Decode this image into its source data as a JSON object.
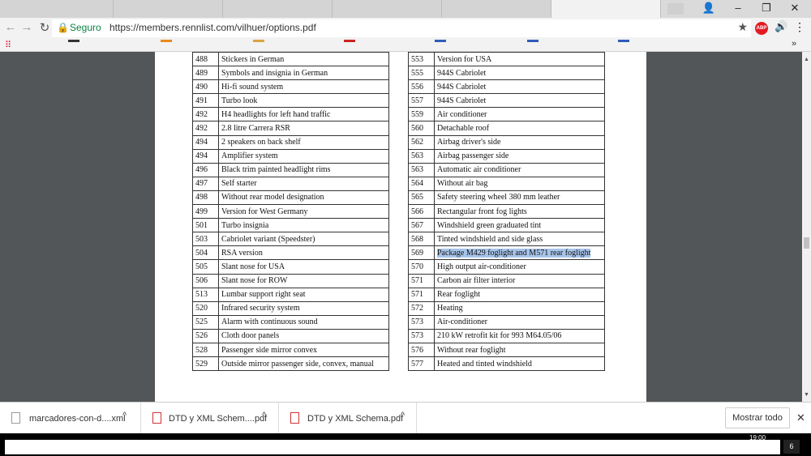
{
  "browser": {
    "secure_label": "Seguro",
    "url": "https://members.rennlist.com/vilhuer/options.pdf",
    "star_icon": "★",
    "ext_abp": "ABP",
    "ext_sound": "🔊",
    "menu_icon": "⋮",
    "bookmarks_more": "»",
    "win_user": "👤",
    "win_min": "–",
    "win_max": "❐",
    "win_close": "✕"
  },
  "options_left": [
    {
      "code": "488",
      "desc": "Stickers in German"
    },
    {
      "code": "489",
      "desc": "Symbols and insignia in German"
    },
    {
      "code": "490",
      "desc": "Hi-fi sound system"
    },
    {
      "code": "491",
      "desc": "Turbo look"
    },
    {
      "code": "492",
      "desc": "H4 headlights for left hand traffic"
    },
    {
      "code": "492",
      "desc": "2.8 litre Carrera RSR"
    },
    {
      "code": "494",
      "desc": "2 speakers on back shelf"
    },
    {
      "code": "494",
      "desc": "Amplifier system"
    },
    {
      "code": "496",
      "desc": "Black trim painted headlight rims"
    },
    {
      "code": "497",
      "desc": "Self starter"
    },
    {
      "code": "498",
      "desc": "Without rear model designation"
    },
    {
      "code": "499",
      "desc": "Version for West Germany"
    },
    {
      "code": "501",
      "desc": "Turbo insignia"
    },
    {
      "code": "503",
      "desc": "Cabriolet variant (Speedster)"
    },
    {
      "code": "504",
      "desc": "RSA version"
    },
    {
      "code": "505",
      "desc": "Slant nose for USA"
    },
    {
      "code": "506",
      "desc": "Slant nose for ROW"
    },
    {
      "code": "513",
      "desc": "Lumbar support right seat"
    },
    {
      "code": "520",
      "desc": "Infrared security system"
    },
    {
      "code": "525",
      "desc": "Alarm with continuous sound"
    },
    {
      "code": "526",
      "desc": "Cloth door panels"
    },
    {
      "code": "528",
      "desc": "Passenger side mirror convex"
    },
    {
      "code": "529",
      "desc": "Outside mirror passenger side, convex, manual"
    }
  ],
  "options_right": [
    {
      "code": "553",
      "desc": "Version for USA"
    },
    {
      "code": "555",
      "desc": "944S Cabriolet"
    },
    {
      "code": "556",
      "desc": "944S Cabriolet"
    },
    {
      "code": "557",
      "desc": "944S Cabriolet"
    },
    {
      "code": "559",
      "desc": "Air conditioner"
    },
    {
      "code": "560",
      "desc": "Detachable roof"
    },
    {
      "code": "562",
      "desc": "Airbag driver's side"
    },
    {
      "code": "563",
      "desc": "Airbag passenger side"
    },
    {
      "code": "563",
      "desc": "Automatic air conditioner"
    },
    {
      "code": "564",
      "desc": "Without air bag"
    },
    {
      "code": "565",
      "desc": "Safety steering wheel 380 mm leather"
    },
    {
      "code": "566",
      "desc": "Rectangular front fog lights"
    },
    {
      "code": "567",
      "desc": "Windshield green graduated tint"
    },
    {
      "code": "568",
      "desc": "Tinted windshield and side glass"
    },
    {
      "code": "569",
      "desc": "Package M429 foglight and M571 rear foglight",
      "selected": true
    },
    {
      "code": "570",
      "desc": "High output air-conditioner"
    },
    {
      "code": "571",
      "desc": "Carbon air filter interior"
    },
    {
      "code": "571",
      "desc": "Rear foglight"
    },
    {
      "code": "572",
      "desc": "Heating"
    },
    {
      "code": "573",
      "desc": "Air-conditioner"
    },
    {
      "code": "573",
      "desc": "210 kW retrofit kit for 993 M64.05/06"
    },
    {
      "code": "576",
      "desc": "Without rear foglight"
    },
    {
      "code": "577",
      "desc": "Heated and tinted windshield"
    }
  ],
  "downloads": {
    "items": [
      {
        "name": "marcadores-con-d....xml",
        "type": "xml"
      },
      {
        "name": "DTD y XML Schem....pdf",
        "type": "pdf"
      },
      {
        "name": "DTD y XML Schema.pdf",
        "type": "pdf"
      }
    ],
    "show_all": "Mostrar todo",
    "close_icon": "✕",
    "caret": "^"
  },
  "taskbar": {
    "time": "19:00",
    "notifications": "6"
  }
}
